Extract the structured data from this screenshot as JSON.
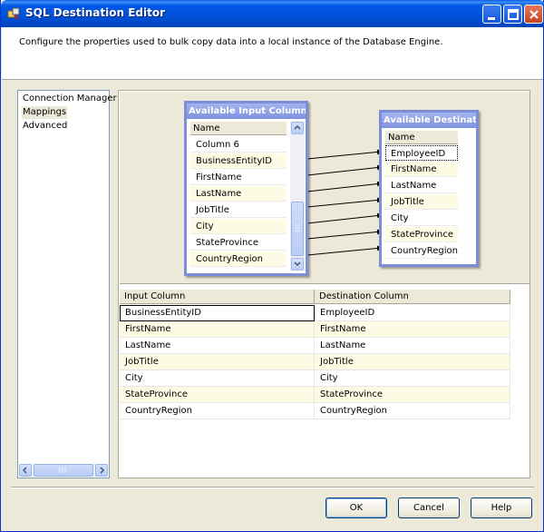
{
  "window": {
    "title": "SQL Destination Editor",
    "icon": "ssis-package-icon"
  },
  "header": {
    "description": "Configure the properties used to bulk copy data into a local instance of the Database Engine."
  },
  "nav": {
    "items": [
      {
        "label": "Connection Manager",
        "selected": false
      },
      {
        "label": "Mappings",
        "selected": true
      },
      {
        "label": "Advanced",
        "selected": false
      }
    ]
  },
  "input_columns": {
    "title": "Available Input Columns",
    "header": "Name",
    "rows": [
      "Column 6",
      "BusinessEntityID",
      "FirstName",
      "LastName",
      "JobTitle",
      "City",
      "StateProvince",
      "CountryRegion"
    ]
  },
  "destination_columns": {
    "title": "Available Destinat...",
    "header": "Name",
    "rows": [
      "EmployeeID",
      "FirstName",
      "LastName",
      "JobTitle",
      "City",
      "StateProvince",
      "CountryRegion"
    ]
  },
  "grid": {
    "headers": [
      "Input Column",
      "Destination Column"
    ],
    "rows": [
      [
        "BusinessEntityID",
        "EmployeeID"
      ],
      [
        "FirstName",
        "FirstName"
      ],
      [
        "LastName",
        "LastName"
      ],
      [
        "JobTitle",
        "JobTitle"
      ],
      [
        "City",
        "City"
      ],
      [
        "StateProvince",
        "StateProvince"
      ],
      [
        "CountryRegion",
        "CountryRegion"
      ]
    ]
  },
  "buttons": {
    "ok": "OK",
    "cancel": "Cancel",
    "help": "Help"
  },
  "colors": {
    "titlebar": "#0058e6",
    "box_border": "#7c8ed8",
    "row_alt": "#fdfbe3"
  }
}
